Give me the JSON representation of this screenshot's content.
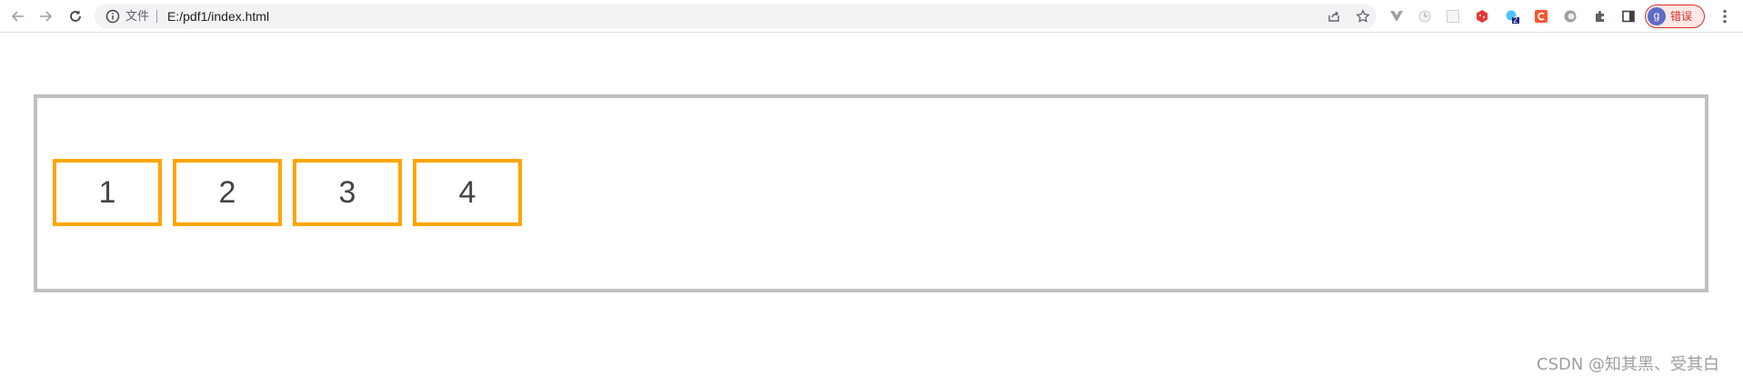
{
  "browser": {
    "file_label": "文件",
    "url": "E:/pdf1/index.html",
    "profile": {
      "avatar_letter": "g",
      "status_text": "错误",
      "status_color": "#d93025",
      "avatar_color": "#5f6bc9"
    },
    "extension_badge": "2",
    "icons": {
      "back": "arrow-left-icon",
      "forward": "arrow-right-icon",
      "reload": "reload-icon",
      "info": "info-icon",
      "share": "share-icon",
      "bookmark": "star-icon",
      "extensions": "puzzle-icon",
      "side_panel": "side-panel-icon",
      "menu": "kebab-menu-icon"
    }
  },
  "page": {
    "container_border_color": "#c0c0c0",
    "item_border_color": "#ffa500",
    "items": [
      "1",
      "2",
      "3",
      "4"
    ]
  },
  "watermark": "CSDN @知其黑、受其白"
}
